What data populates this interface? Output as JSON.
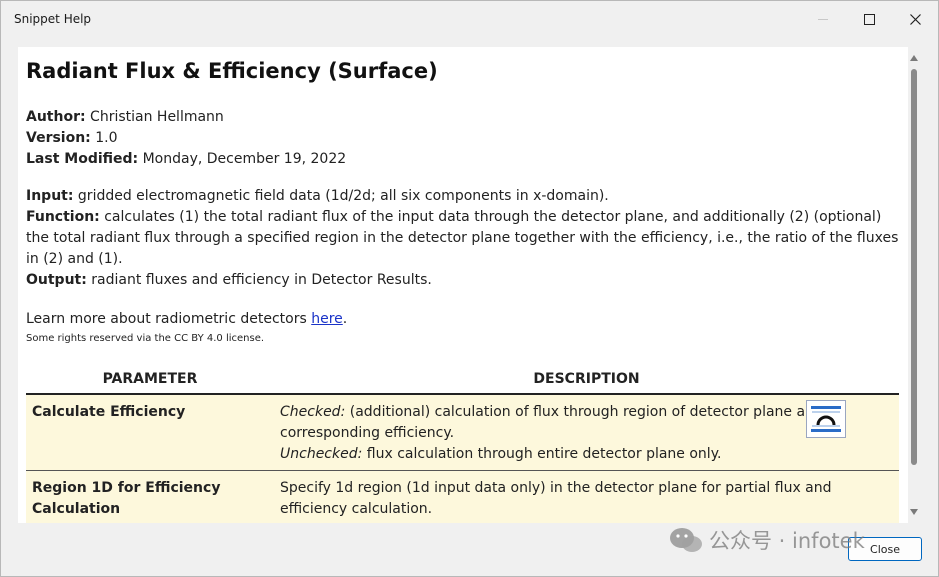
{
  "window": {
    "title": "Snippet Help"
  },
  "doc": {
    "title": "Radiant Flux & Efficiency (Surface)",
    "author_label": "Author:",
    "author": "Christian Hellmann",
    "version_label": "Version:",
    "version": "1.0",
    "modified_label": "Last Modified:",
    "modified": "Monday, December 19, 2022",
    "input_label": "Input:",
    "input": "gridded electromagnetic field data (1d/2d; all six components in x-domain).",
    "function_label": "Function:",
    "function": "calculates (1) the total radiant flux of the input data through the detector plane, and additionally (2) (optional) the total radiant flux through a specified region in the detector plane together with the efficiency, i.e., the ratio of the fluxes in (2) and (1).",
    "output_label": "Output:",
    "output": "radiant fluxes and efficiency in Detector Results.",
    "learn_more": "Learn more about radiometric detectors ",
    "learn_link": "here",
    "learn_end": ".",
    "license": "Some rights reserved via the CC BY 4.0 license."
  },
  "table": {
    "headers": [
      "PARAMETER",
      "DESCRIPTION"
    ],
    "rows": [
      {
        "name": "Calculate Efficiency",
        "checked_label": "Checked:",
        "checked_text": "(additional) calculation of flux through region of detector plane and corresponding efficiency.",
        "unchecked_label": "Unchecked:",
        "unchecked_text": "flux calculation through entire detector plane only."
      },
      {
        "name": "Region 1D for Efficiency Calculation",
        "description": "Specify 1d region (1d input data only) in the detector plane for partial flux and efficiency calculation."
      }
    ]
  },
  "buttons": {
    "close": "Close"
  },
  "watermark": {
    "text": "公众号 · infotek"
  },
  "icons": [
    "minimize-icon",
    "maximize-icon",
    "close-icon",
    "detector-icon",
    "wechat-icon"
  ]
}
